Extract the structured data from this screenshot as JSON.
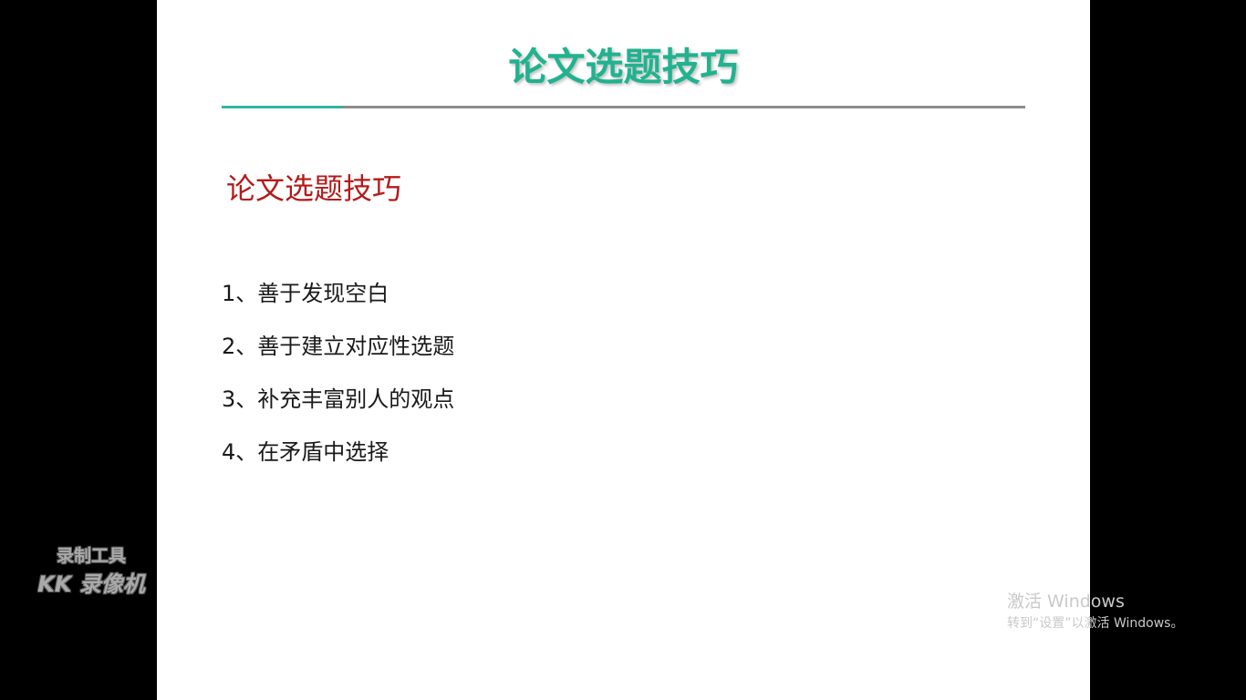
{
  "slide": {
    "title": "论文选题技巧",
    "section_heading": "论文选题技巧",
    "points": [
      "1、善于发现空白",
      "2、善于建立对应性选题",
      "3、补充丰富别人的观点",
      "4、在矛盾中选择"
    ]
  },
  "watermark": {
    "line1": "录制工具",
    "line2": "KK 录像机"
  },
  "activation": {
    "title": "激活 Windows",
    "subtitle": "转到“设置”以激活 Windows。"
  },
  "colors": {
    "title": "#21b28f",
    "rule": "#8c8c8c",
    "rule_accent": "#2fb6a3",
    "section_heading": "#b31b1b",
    "background": "#000000",
    "slide": "#ffffff"
  }
}
